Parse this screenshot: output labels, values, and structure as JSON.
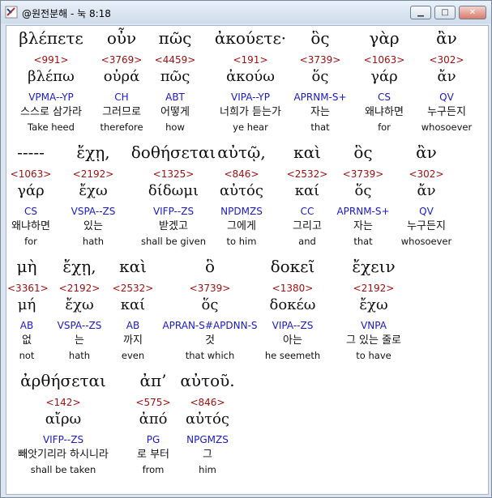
{
  "window": {
    "title": "@원전분해 - 눅 8:18"
  },
  "verse_blocks": [
    {
      "greek": "βλέπετε",
      "strong": "<991>",
      "lemma": "βλέπω",
      "parse": "VPMA--YP",
      "korean": "스스로 삼가라",
      "english": "Take heed"
    },
    {
      "greek": "οὖν",
      "strong": "<3769>",
      "lemma": "οὐρά",
      "parse": "CH",
      "korean": "그러므로",
      "english": "therefore"
    },
    {
      "greek": "πῶς",
      "strong": "<4459>",
      "lemma": "πῶς",
      "parse": "ABT",
      "korean": "어떻게",
      "english": "how"
    },
    {
      "greek": "ἀκούετε·",
      "strong": "<191>",
      "lemma": "ἀκούω",
      "parse": "VIPA--YP",
      "korean": "너희가 듣는가",
      "english": "ye hear"
    },
    {
      "greek": "ὃς",
      "strong": "<3739>",
      "lemma": "ὅς",
      "parse": "APRNM-S+",
      "korean": "자는",
      "english": "that"
    },
    {
      "greek": "γὰρ",
      "strong": "<1063>",
      "lemma": "γάρ",
      "parse": "CS",
      "korean": "왜냐하면",
      "english": "for"
    },
    {
      "greek": "ἂν",
      "strong": "<302>",
      "lemma": "ἄν",
      "parse": "QV",
      "korean": "누구든지",
      "english": "whosoever"
    },
    {
      "greek": "-----",
      "strong": "<1063>",
      "lemma": "γάρ",
      "parse": "CS",
      "korean": "왜냐하면",
      "english": "for"
    },
    {
      "greek": "ἔχῃ,",
      "strong": "<2192>",
      "lemma": "ἔχω",
      "parse": "VSPA--ZS",
      "korean": "있는",
      "english": "hath"
    },
    {
      "greek": "δοθήσεται",
      "strong": "<1325>",
      "lemma": "δίδωμι",
      "parse": "VIFP--ZS",
      "korean": "받겠고",
      "english": "shall be given"
    },
    {
      "greek": "αὐτῷ,",
      "strong": "<846>",
      "lemma": "αὐτός",
      "parse": "NPDMZS",
      "korean": "그에게",
      "english": "to him"
    },
    {
      "greek": "καὶ",
      "strong": "<2532>",
      "lemma": "καί",
      "parse": "CC",
      "korean": "그리고",
      "english": "and"
    },
    {
      "greek": "ὃς",
      "strong": "<3739>",
      "lemma": "ὅς",
      "parse": "APRNM-S+",
      "korean": "자는",
      "english": "that"
    },
    {
      "greek": "ἂν",
      "strong": "<302>",
      "lemma": "ἄν",
      "parse": "QV",
      "korean": "누구든지",
      "english": "whosoever"
    },
    {
      "greek": "μὴ",
      "strong": "<3361>",
      "lemma": "μή",
      "parse": "AB",
      "korean": "없",
      "english": "not"
    },
    {
      "greek": "ἔχῃ,",
      "strong": "<2192>",
      "lemma": "ἔχω",
      "parse": "VSPA--ZS",
      "korean": "는",
      "english": "hath"
    },
    {
      "greek": "καὶ",
      "strong": "<2532>",
      "lemma": "καί",
      "parse": "AB",
      "korean": "까지",
      "english": "even"
    },
    {
      "greek": "ὃ",
      "strong": "<3739>",
      "lemma": "ὅς",
      "parse": "APRAN-S#APDNN-S",
      "korean": "것",
      "english": "that which"
    },
    {
      "greek": "δοκεῖ",
      "strong": "<1380>",
      "lemma": "δοκέω",
      "parse": "VIPA--ZS",
      "korean": "아는",
      "english": "he seemeth"
    },
    {
      "greek": "ἔχειν",
      "strong": "<2192>",
      "lemma": "ἔχω",
      "parse": "VNPA",
      "korean": "그 있는 줄로",
      "english": "to have"
    },
    {
      "greek": "ἀρθήσεται",
      "strong": "<142>",
      "lemma": "αἴρω",
      "parse": "VIFP--ZS",
      "korean": "빼앗기리라 하시니라",
      "english": "shall be taken"
    },
    {
      "greek": "ἀπ’",
      "strong": "<575>",
      "lemma": "ἀπό",
      "parse": "PG",
      "korean": "로 부터",
      "english": "from"
    },
    {
      "greek": "αὐτοῦ.",
      "strong": "<846>",
      "lemma": "αὐτός",
      "parse": "NPGMZS",
      "korean": "그",
      "english": "him"
    }
  ],
  "colors": {
    "strong": "#a01010",
    "parse": "#1a1acc",
    "text": "#111111"
  }
}
